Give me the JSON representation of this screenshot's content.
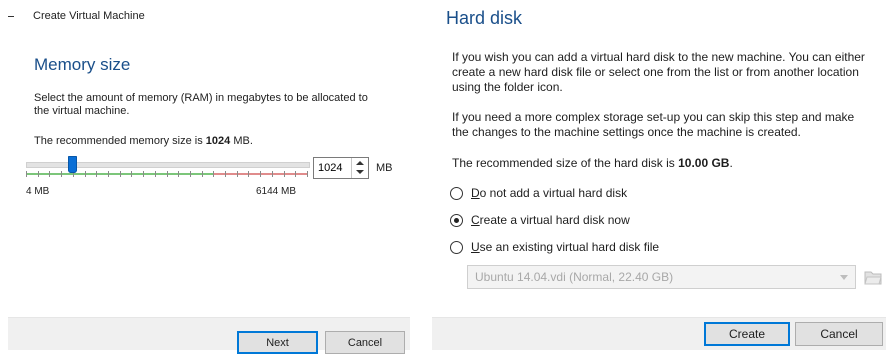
{
  "memory_wizard": {
    "window_title": "Create Virtual Machine",
    "section_title": "Memory size",
    "description": "Select the amount of memory (RAM) in megabytes to be allocated to the virtual machine.",
    "recommended_prefix": "The recommended memory size is ",
    "recommended_value": "1024",
    "recommended_suffix": " MB.",
    "slider": {
      "min_label": "4 MB",
      "max_label": "6144 MB",
      "min": 4,
      "max": 6144,
      "value": 1024,
      "safe_max": 4096,
      "safe_color": "#7cc67a",
      "unsafe_color": "#e08c8c",
      "thumb_color": "#0a6fd6"
    },
    "spin_value": "1024",
    "unit": "MB",
    "buttons": {
      "next": "Next",
      "cancel": "Cancel"
    }
  },
  "harddisk_wizard": {
    "section_title": "Hard disk",
    "para1": "If you wish you can add a virtual hard disk to the new machine. You can either create a new hard disk file or select one from the list or from another location using the folder icon.",
    "para2": "If you need a more complex storage set-up you can skip this step and make the changes to the machine settings once the machine is created.",
    "recommended_prefix": "The recommended size of the hard disk is ",
    "recommended_value": "10.00 GB",
    "recommended_suffix": ".",
    "options": [
      {
        "mnemonic": "D",
        "rest": "o not add a virtual hard disk",
        "checked": false
      },
      {
        "mnemonic": "C",
        "rest": "reate a virtual hard disk now",
        "checked": true
      },
      {
        "mnemonic": "U",
        "rest": "se an existing virtual hard disk file",
        "checked": false
      }
    ],
    "existing_disk": "Ubuntu 14.04.vdi (Normal, 22.40 GB)",
    "folder_icon": "folder-icon",
    "buttons": {
      "create": "Create",
      "cancel": "Cancel"
    }
  }
}
